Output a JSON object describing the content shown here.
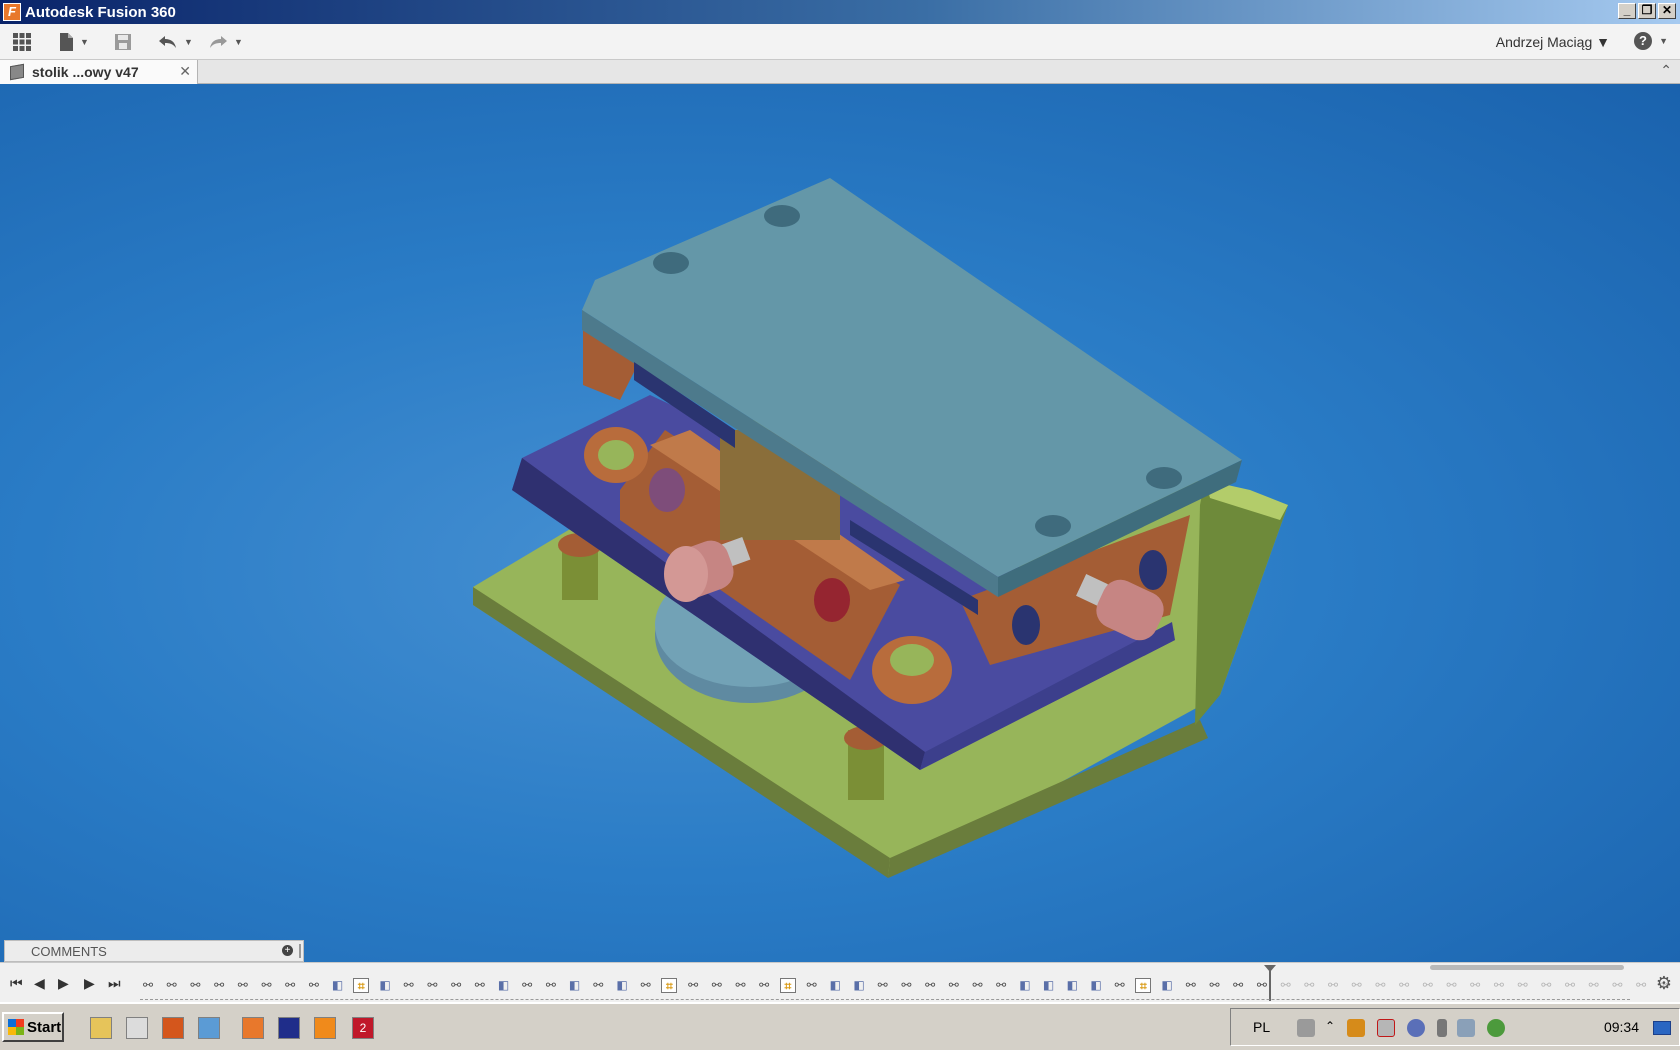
{
  "window": {
    "title": "Autodesk Fusion 360",
    "app_icon": "F",
    "controls": {
      "minimize": "_",
      "restore": "❐",
      "close": "✕"
    }
  },
  "toolbar": {
    "data_panel_icon": "grid-icon",
    "file_icon": "file-icon",
    "save_icon": "save-icon",
    "undo_icon": "undo-icon",
    "redo_icon": "redo-icon",
    "user_name": "Andrzej Maciąg ▼",
    "help_label": "?"
  },
  "tabs": [
    {
      "label": "stolik ...owy v47",
      "close": "✕",
      "active": true
    }
  ],
  "viewport": {
    "background_color": "#2a7cc6",
    "model": {
      "base_plate_color": "#97b55a",
      "slide_plate_color": "#3c3f8c",
      "top_plate_color": "#6497a8",
      "block_color": "#a45d35",
      "knob_color": "#c68583"
    }
  },
  "comments": {
    "label": "COMMENTS",
    "add": "+"
  },
  "timeline": {
    "playback": [
      "⏮",
      "◀",
      "▶",
      "▶",
      "⏭"
    ],
    "settings_icon": "⚙"
  },
  "taskbar": {
    "start_label": "Start",
    "quick_launch": [
      {
        "name": "folder",
        "color": "#e6c45a"
      },
      {
        "name": "media",
        "color": "#dcdcdc"
      },
      {
        "name": "firefox",
        "color": "#d4561c"
      },
      {
        "name": "app",
        "color": "#5b9bd5"
      },
      {
        "name": "fusion",
        "color": "#e8782c"
      },
      {
        "name": "save-app",
        "color": "#1f2d8a"
      },
      {
        "name": "vlc",
        "color": "#f08a1b"
      },
      {
        "name": "ezcad",
        "color": "#c0182a"
      }
    ],
    "ezcad_label": "2",
    "language": "PL",
    "clock": "09:34"
  }
}
